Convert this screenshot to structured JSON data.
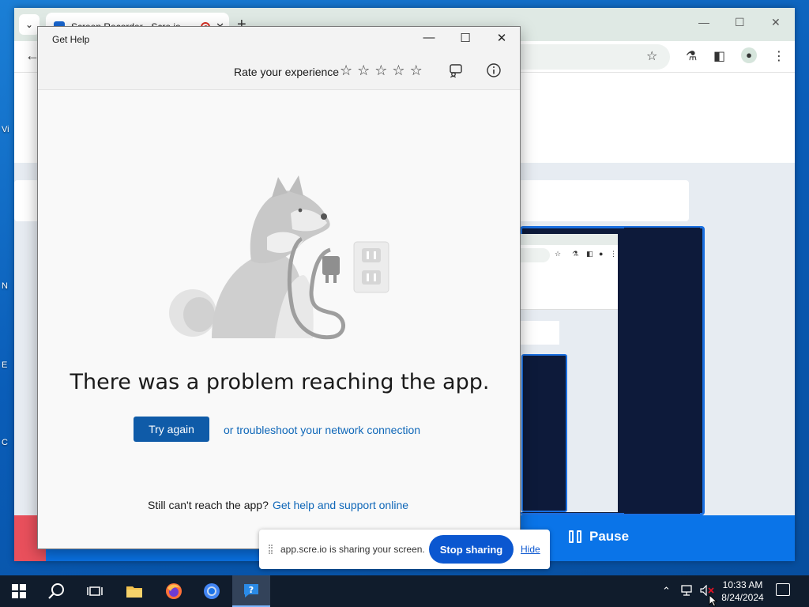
{
  "desktop": {
    "icon_labels": [
      "Vi",
      "N",
      "E",
      "C"
    ]
  },
  "chrome": {
    "tab_title": "Screen Recorder - Scre.io",
    "new_tab": "+",
    "minimize": "—",
    "maximize": "☐",
    "close": "✕"
  },
  "recorder": {
    "pause_label": "Pause"
  },
  "get_help": {
    "window_title": "Get Help",
    "rate_label": "Rate your experience",
    "stars": [
      "☆",
      "☆",
      "☆",
      "☆",
      "☆"
    ],
    "heading": "There was a problem reaching the app.",
    "try_again": "Try again",
    "troubleshoot_link": "or troubleshoot your network connection",
    "still_cant": "Still can't reach the app?",
    "help_link": "Get help and support online",
    "minimize": "—",
    "maximize": "☐",
    "close": "✕"
  },
  "share_bar": {
    "message": "app.scre.io is sharing your screen.",
    "stop_label": "Stop sharing",
    "hide_label": "Hide"
  },
  "taskbar": {
    "time": "10:33 AM",
    "date": "8/24/2024"
  },
  "colors": {
    "accent_blue": "#0f5ba8",
    "link_blue": "#0f67b8",
    "recorder_blue": "#0a74e8",
    "share_blue": "#0b57d0"
  }
}
